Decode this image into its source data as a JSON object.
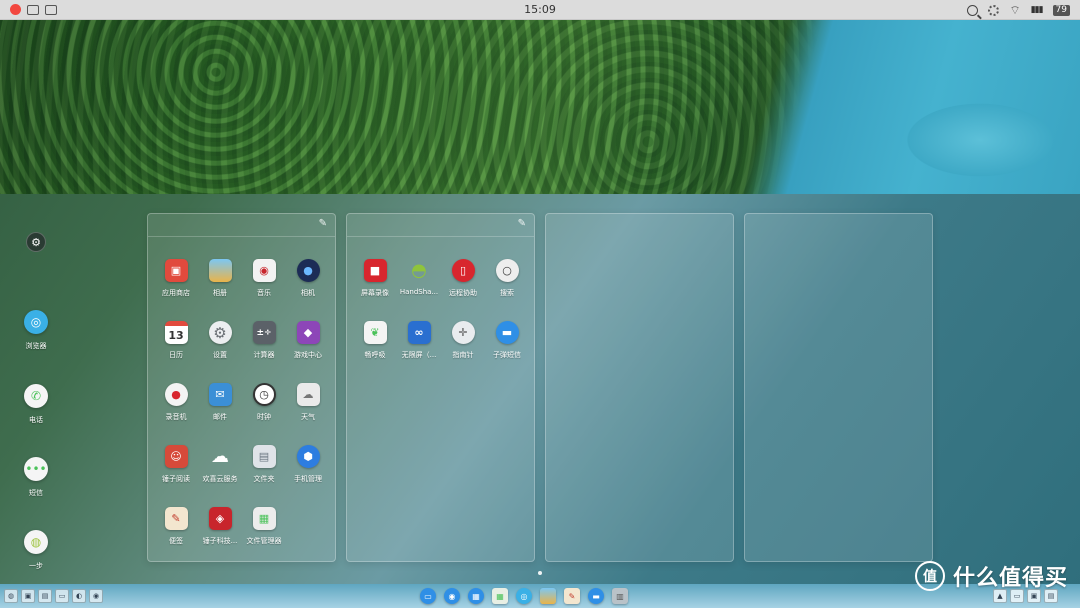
{
  "status_bar": {
    "time": "15:09",
    "battery": "79",
    "icons": [
      "close-icon",
      "screenshot-icon",
      "display-icon",
      "search-icon",
      "settings-icon",
      "wifi-icon",
      "signal-icon",
      "battery-icon"
    ]
  },
  "left_dock": {
    "items": [
      {
        "label": "",
        "icon": "settings-icon",
        "color": "#2a3b33"
      },
      {
        "label": "浏览器",
        "icon": "browser-icon",
        "color": "#3ab0e6"
      },
      {
        "label": "电话",
        "icon": "phone-icon",
        "color": "#4bc25a"
      },
      {
        "label": "短信",
        "icon": "sms-icon",
        "color": "#4bc25a"
      },
      {
        "label": "一步",
        "icon": "onestep-icon",
        "color": "#9ec43f"
      }
    ]
  },
  "panels": [
    {
      "editable": true,
      "apps": [
        {
          "label": "应用商店",
          "icon": "app-store-icon",
          "color": "#e14a3d"
        },
        {
          "label": "相册",
          "icon": "gallery-icon",
          "color": "#48a6e0"
        },
        {
          "label": "音乐",
          "icon": "music-icon",
          "color": "#3a3a3a"
        },
        {
          "label": "相机",
          "icon": "camera-icon",
          "color": "#1c2c56"
        },
        {
          "label": "日历",
          "icon": "calendar-icon",
          "color": "#ffffff",
          "text": "13"
        },
        {
          "label": "设置",
          "icon": "settings-icon",
          "color": "#8b8f93"
        },
        {
          "label": "计算器",
          "icon": "calculator-icon",
          "color": "#5b6168"
        },
        {
          "label": "游戏中心",
          "icon": "game-center-icon",
          "color": "#8d46b8"
        },
        {
          "label": "录音机",
          "icon": "recorder-icon",
          "color": "#f3f3f3"
        },
        {
          "label": "邮件",
          "icon": "mail-icon",
          "color": "#3b8fd6"
        },
        {
          "label": "时钟",
          "icon": "clock-icon",
          "color": "#ffffff"
        },
        {
          "label": "天气",
          "icon": "weather-icon",
          "color": "#eaeaea"
        },
        {
          "label": "锤子阅读",
          "icon": "reader-icon",
          "color": "#d64a3a"
        },
        {
          "label": "欢喜云服务",
          "icon": "cloud-icon",
          "color": "#f2f2f2"
        },
        {
          "label": "文件夹",
          "icon": "folder-icon",
          "color": "#dfe3e8"
        },
        {
          "label": "手机管理",
          "icon": "phone-manager-icon",
          "color": "#2d7de0"
        },
        {
          "label": "便签",
          "icon": "notes-icon",
          "color": "#f3e6cf"
        },
        {
          "label": "锤子科技...",
          "icon": "smartisan-icon",
          "color": "#c8252c"
        },
        {
          "label": "文件管理器",
          "icon": "file-manager-icon",
          "color": "#ececec"
        }
      ]
    },
    {
      "editable": true,
      "apps": [
        {
          "label": "屏幕录像",
          "icon": "screen-record-icon",
          "color": "#d8262e"
        },
        {
          "label": "HandSha...",
          "icon": "android-icon",
          "color": "#8fc43c"
        },
        {
          "label": "远程协助",
          "icon": "remote-assist-icon",
          "color": "#d8262e"
        },
        {
          "label": "搜索",
          "icon": "search-icon",
          "color": "#eeeeee"
        },
        {
          "label": "畅呼吸",
          "icon": "breathe-icon",
          "color": "#f4f4f4"
        },
        {
          "label": "无限屏（...",
          "icon": "infinite-screen-icon",
          "color": "#2a6fd0"
        },
        {
          "label": "指南针",
          "icon": "compass-icon",
          "color": "#e9ecef"
        },
        {
          "label": "子弹短信",
          "icon": "bullet-sms-icon",
          "color": "#2f8fe6"
        }
      ]
    },
    {
      "editable": false,
      "apps": []
    },
    {
      "editable": false,
      "apps": []
    }
  ],
  "taskbar": {
    "left_icons": [
      "window-icon",
      "tile-icon",
      "multi-window-icon",
      "screen-icon",
      "toggle-icon",
      "record-icon"
    ],
    "center_icons": [
      {
        "icon": "folder-icon",
        "color": "#2f8fe6"
      },
      {
        "icon": "browser-icon",
        "color": "#2f8fe6"
      },
      {
        "icon": "apps-icon",
        "color": "#2f8fe6"
      },
      {
        "icon": "file-manager-icon",
        "color": "#e8efe4"
      },
      {
        "icon": "browser-icon",
        "color": "#3ab0e6"
      },
      {
        "icon": "gallery-icon",
        "color": "#48a6e0"
      },
      {
        "icon": "notes-icon",
        "color": "#f3e6cf"
      },
      {
        "icon": "bullet-sms-icon",
        "color": "#2f8fe6"
      },
      {
        "icon": "trash-icon",
        "color": "#b9c2c8"
      }
    ],
    "right_icons": [
      "photo-icon",
      "window-icon",
      "tile-icon",
      "multi-window-icon"
    ]
  },
  "watermark": {
    "logo_text": "值",
    "text": "什么值得买"
  }
}
